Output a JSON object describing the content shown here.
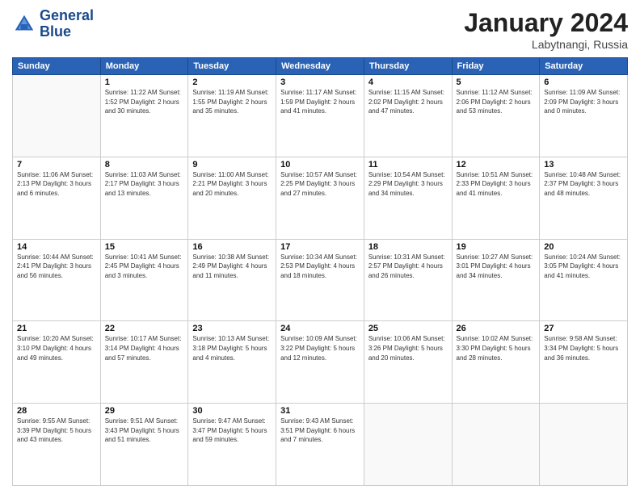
{
  "logo": {
    "line1": "General",
    "line2": "Blue"
  },
  "title": "January 2024",
  "location": "Labytnangi, Russia",
  "days_of_week": [
    "Sunday",
    "Monday",
    "Tuesday",
    "Wednesday",
    "Thursday",
    "Friday",
    "Saturday"
  ],
  "weeks": [
    [
      {
        "day": "",
        "info": ""
      },
      {
        "day": "1",
        "info": "Sunrise: 11:22 AM\nSunset: 1:52 PM\nDaylight: 2 hours\nand 30 minutes."
      },
      {
        "day": "2",
        "info": "Sunrise: 11:19 AM\nSunset: 1:55 PM\nDaylight: 2 hours\nand 35 minutes."
      },
      {
        "day": "3",
        "info": "Sunrise: 11:17 AM\nSunset: 1:59 PM\nDaylight: 2 hours\nand 41 minutes."
      },
      {
        "day": "4",
        "info": "Sunrise: 11:15 AM\nSunset: 2:02 PM\nDaylight: 2 hours\nand 47 minutes."
      },
      {
        "day": "5",
        "info": "Sunrise: 11:12 AM\nSunset: 2:06 PM\nDaylight: 2 hours\nand 53 minutes."
      },
      {
        "day": "6",
        "info": "Sunrise: 11:09 AM\nSunset: 2:09 PM\nDaylight: 3 hours\nand 0 minutes."
      }
    ],
    [
      {
        "day": "7",
        "info": "Sunrise: 11:06 AM\nSunset: 2:13 PM\nDaylight: 3 hours\nand 6 minutes."
      },
      {
        "day": "8",
        "info": "Sunrise: 11:03 AM\nSunset: 2:17 PM\nDaylight: 3 hours\nand 13 minutes."
      },
      {
        "day": "9",
        "info": "Sunrise: 11:00 AM\nSunset: 2:21 PM\nDaylight: 3 hours\nand 20 minutes."
      },
      {
        "day": "10",
        "info": "Sunrise: 10:57 AM\nSunset: 2:25 PM\nDaylight: 3 hours\nand 27 minutes."
      },
      {
        "day": "11",
        "info": "Sunrise: 10:54 AM\nSunset: 2:29 PM\nDaylight: 3 hours\nand 34 minutes."
      },
      {
        "day": "12",
        "info": "Sunrise: 10:51 AM\nSunset: 2:33 PM\nDaylight: 3 hours\nand 41 minutes."
      },
      {
        "day": "13",
        "info": "Sunrise: 10:48 AM\nSunset: 2:37 PM\nDaylight: 3 hours\nand 48 minutes."
      }
    ],
    [
      {
        "day": "14",
        "info": "Sunrise: 10:44 AM\nSunset: 2:41 PM\nDaylight: 3 hours\nand 56 minutes."
      },
      {
        "day": "15",
        "info": "Sunrise: 10:41 AM\nSunset: 2:45 PM\nDaylight: 4 hours\nand 3 minutes."
      },
      {
        "day": "16",
        "info": "Sunrise: 10:38 AM\nSunset: 2:49 PM\nDaylight: 4 hours\nand 11 minutes."
      },
      {
        "day": "17",
        "info": "Sunrise: 10:34 AM\nSunset: 2:53 PM\nDaylight: 4 hours\nand 18 minutes."
      },
      {
        "day": "18",
        "info": "Sunrise: 10:31 AM\nSunset: 2:57 PM\nDaylight: 4 hours\nand 26 minutes."
      },
      {
        "day": "19",
        "info": "Sunrise: 10:27 AM\nSunset: 3:01 PM\nDaylight: 4 hours\nand 34 minutes."
      },
      {
        "day": "20",
        "info": "Sunrise: 10:24 AM\nSunset: 3:05 PM\nDaylight: 4 hours\nand 41 minutes."
      }
    ],
    [
      {
        "day": "21",
        "info": "Sunrise: 10:20 AM\nSunset: 3:10 PM\nDaylight: 4 hours\nand 49 minutes."
      },
      {
        "day": "22",
        "info": "Sunrise: 10:17 AM\nSunset: 3:14 PM\nDaylight: 4 hours\nand 57 minutes."
      },
      {
        "day": "23",
        "info": "Sunrise: 10:13 AM\nSunset: 3:18 PM\nDaylight: 5 hours\nand 4 minutes."
      },
      {
        "day": "24",
        "info": "Sunrise: 10:09 AM\nSunset: 3:22 PM\nDaylight: 5 hours\nand 12 minutes."
      },
      {
        "day": "25",
        "info": "Sunrise: 10:06 AM\nSunset: 3:26 PM\nDaylight: 5 hours\nand 20 minutes."
      },
      {
        "day": "26",
        "info": "Sunrise: 10:02 AM\nSunset: 3:30 PM\nDaylight: 5 hours\nand 28 minutes."
      },
      {
        "day": "27",
        "info": "Sunrise: 9:58 AM\nSunset: 3:34 PM\nDaylight: 5 hours\nand 36 minutes."
      }
    ],
    [
      {
        "day": "28",
        "info": "Sunrise: 9:55 AM\nSunset: 3:39 PM\nDaylight: 5 hours\nand 43 minutes."
      },
      {
        "day": "29",
        "info": "Sunrise: 9:51 AM\nSunset: 3:43 PM\nDaylight: 5 hours\nand 51 minutes."
      },
      {
        "day": "30",
        "info": "Sunrise: 9:47 AM\nSunset: 3:47 PM\nDaylight: 5 hours\nand 59 minutes."
      },
      {
        "day": "31",
        "info": "Sunrise: 9:43 AM\nSunset: 3:51 PM\nDaylight: 6 hours\nand 7 minutes."
      },
      {
        "day": "",
        "info": ""
      },
      {
        "day": "",
        "info": ""
      },
      {
        "day": "",
        "info": ""
      }
    ]
  ]
}
